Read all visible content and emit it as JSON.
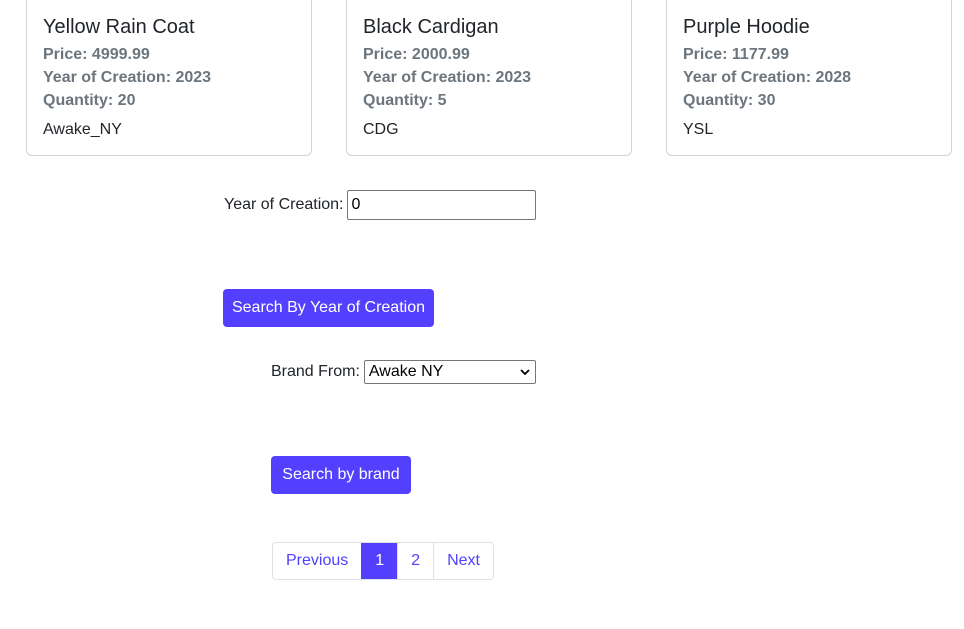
{
  "products": [
    {
      "name": "Yellow Rain Coat",
      "price": "Price: 4999.99",
      "year": "Year of Creation: 2023",
      "quantity": "Quantity: 20",
      "brand": "Awake_NY"
    },
    {
      "name": "Black Cardigan",
      "price": "Price: 2000.99",
      "year": "Year of Creation: 2023",
      "quantity": "Quantity: 5",
      "brand": "CDG"
    },
    {
      "name": "Purple Hoodie",
      "price": "Price: 1177.99",
      "year": "Year of Creation: 2028",
      "quantity": "Quantity: 30",
      "brand": "YSL"
    }
  ],
  "year_search": {
    "label": "Year of Creation:",
    "value": "0",
    "button": "Search By Year of Creation"
  },
  "brand_search": {
    "label": "Brand From:",
    "selected": "Awake NY",
    "button": "Search by brand"
  },
  "pagination": {
    "previous": "Previous",
    "pages": [
      "1",
      "2"
    ],
    "active": "1",
    "next": "Next"
  },
  "colors": {
    "accent": "#5340ff",
    "muted_text": "#6c757d"
  }
}
